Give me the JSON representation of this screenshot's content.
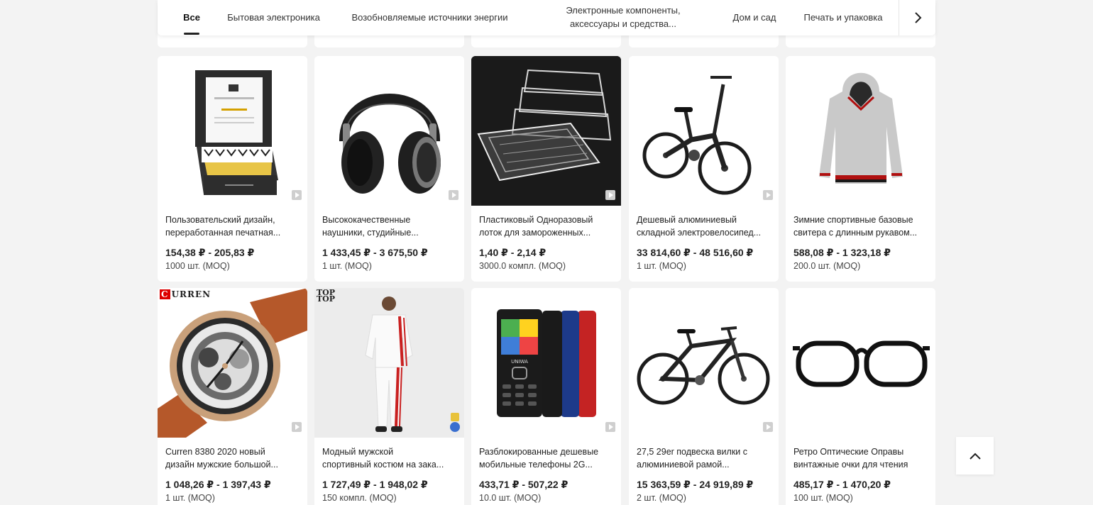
{
  "tabs": [
    {
      "label": "Все",
      "active": true
    },
    {
      "label": "Бытовая электроника"
    },
    {
      "label": "Возобновляемые источники энергии"
    },
    {
      "label_line1": "Электронные компоненты,",
      "label_line2": "аксессуары и средства..."
    },
    {
      "label": "Дом и сад"
    },
    {
      "label": "Печать и упаковка"
    }
  ],
  "products": [
    {
      "title1": "Пользовательский дизайн,",
      "title2": "переработанная печатная...",
      "price": "154,38 ₽ - 205,83 ₽",
      "moq": "1000 шт. (MOQ)",
      "image": "printed-mailer-box",
      "has_video": true
    },
    {
      "title1": "Высококачественные",
      "title2": "наушники, студийные...",
      "price": "1 433,45 ₽ - 3 675,50 ₽",
      "moq": "1 шт. (MOQ)",
      "image": "headphones",
      "has_video": true
    },
    {
      "title1": "Пластиковый Одноразовый",
      "title2": "лоток для замороженных...",
      "price": "1,40 ₽ - 2,14 ₽",
      "moq": "3000.0 компл. (MOQ)",
      "image": "plastic-trays",
      "has_video": true
    },
    {
      "title1": "Дешевый алюминиевый",
      "title2": "складной электровелосипед...",
      "price": "33 814,60 ₽ - 48 516,60 ₽",
      "moq": "1 шт. (MOQ)",
      "image": "folding-ebike",
      "has_video": true
    },
    {
      "title1": "Зимние спортивные базовые",
      "title2": "свитера с длинным рукавом...",
      "price": "588,08 ₽ - 1 323,18 ₽",
      "moq": "200.0 шт. (MOQ)",
      "image": "grey-hoodie",
      "has_video": false
    },
    {
      "title1": "Curren 8380 2020 новый",
      "title2": "дизайн мужские большой...",
      "price": "1 048,26 ₽ - 1 397,43 ₽",
      "moq": "1 шт. (MOQ)",
      "image": "wristwatch",
      "has_video": true,
      "brand": "URREN",
      "brand_initial": "C"
    },
    {
      "title1": "Модный мужской",
      "title2": "спортивный костюм на зака...",
      "price": "1 727,49 ₽ - 1 948,02 ₽",
      "moq": "150 компл. (MOQ)",
      "image": "white-tracksuit",
      "has_video": false,
      "badge_top1": "TOP",
      "badge_top2": "TOP"
    },
    {
      "title1": "Разблокированные дешевые",
      "title2": "мобильные телефоны 2G...",
      "price": "433,71 ₽ - 507,22 ₽",
      "moq": "10.0 шт. (MOQ)",
      "image": "feature-phones",
      "has_video": true,
      "phone_brand": "UNIWA"
    },
    {
      "title1": "27,5 29er подвеска вилки с",
      "title2": "алюминиевой рамой...",
      "price": "15 363,59 ₽ - 24 919,89 ₽",
      "moq": "2 шт. (MOQ)",
      "image": "mountain-bike",
      "has_video": true
    },
    {
      "title1": "Ретро Оптические Оправы",
      "title2": "винтажные очки для чтения",
      "price": "485,17 ₽ - 1 470,20 ₽",
      "moq": "100 шт. (MOQ)",
      "image": "eyeglasses",
      "has_video": false
    }
  ],
  "icons": {
    "next": "chevron-right-icon",
    "back_to_top": "chevron-up-icon",
    "video": "play-icon"
  }
}
